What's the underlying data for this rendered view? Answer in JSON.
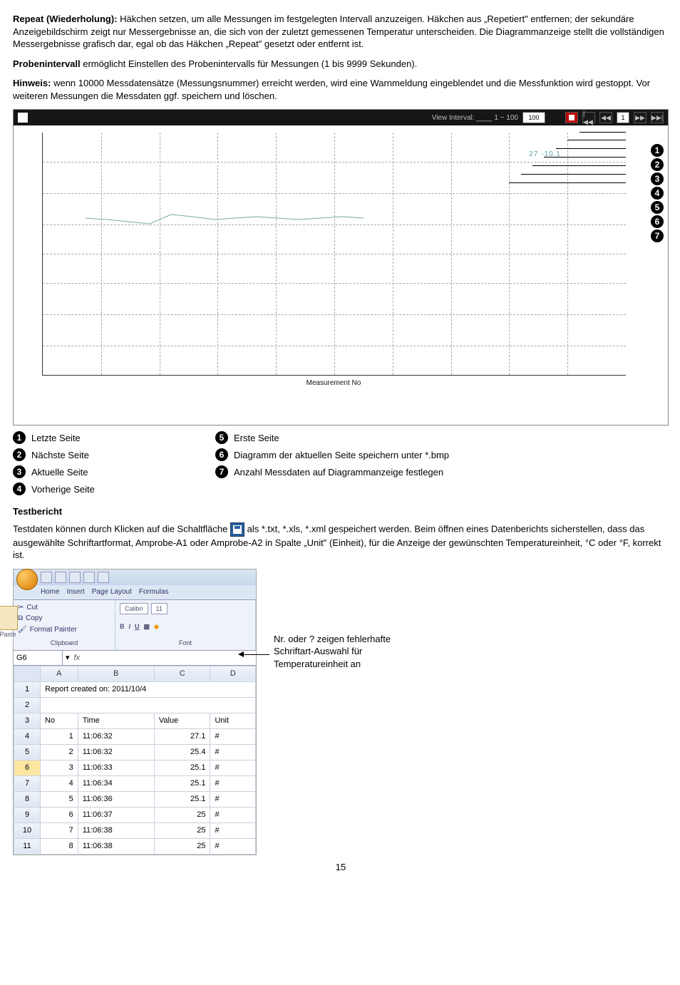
{
  "p1": {
    "title": "Repeat (Wiederholung):",
    "text": " Häkchen setzen, um alle Messungen im festgelegten Intervall anzuzeigen. Häkchen aus „Repetiert\" entfernen; der sekundäre Anzeigebildschirm zeigt nur Messergebnisse an, die sich von der zuletzt gemessenen Temperatur unterscheiden. Die Diagrammanzeige stellt die vollständigen Messergebnisse grafisch dar, egal ob das Häkchen „Repeat\" gesetzt oder entfernt ist."
  },
  "p2": {
    "title": "Probenintervall",
    "text": " ermöglicht Einstellen des Probenintervalls für Messungen (1 bis 9999 Sekunden)."
  },
  "p3": {
    "title": "Hinweis:",
    "text": " wenn 10000 Messdatensätze (Messungsnummer) erreicht werden, wird eine Warnmeldung eingeblendet und die Messfunktion wird gestoppt. Vor weiteren Messungen die Messdaten ggf. speichern und löschen."
  },
  "chart": {
    "header_text": "View Interval: ____ 1 ~ 100",
    "header_count": "100",
    "btn_first": "|◀◀",
    "btn_prev": "◀◀",
    "btn_page": "1",
    "btn_next": "▶▶",
    "btn_last": "▶▶|",
    "annot": "27   -10.1",
    "xlabel": "Measurement No"
  },
  "legend": [
    {
      "num": "1",
      "text": "Letzte Seite"
    },
    {
      "num": "2",
      "text": "Nächste Seite"
    },
    {
      "num": "3",
      "text": "Aktuelle Seite"
    },
    {
      "num": "4",
      "text": "Vorherige Seite"
    },
    {
      "num": "5",
      "text": "Erste Seite"
    },
    {
      "num": "6",
      "text": "Diagramm der aktuellen Seite speichern unter *.bmp"
    },
    {
      "num": "7",
      "text": "Anzahl Messdaten auf Diagrammanzeige festlegen"
    }
  ],
  "testbericht": {
    "title": "Testbericht",
    "text1": "Testdaten können durch Klicken auf die Schaltfläche ",
    "text2": " als *.txt, *.xls, *.xml gespeichert werden. Beim öffnen eines Datenberichts sicherstellen, dass das ausgewählte Schriftartformat, Amprobe-A1 oder Amprobe-A2 in Spalte „Unit\" (Einheit), für die Anzeige der gewünschten Temperatureinheit, °C oder °F, korrekt ist."
  },
  "excel": {
    "tabs": [
      "Home",
      "Insert",
      "Page Layout",
      "Formulas"
    ],
    "clip": {
      "cut": "Cut",
      "copy": "Copy",
      "fp": "Format Painter",
      "label": "Clipboard"
    },
    "font": {
      "name": "Calibri",
      "size": "11",
      "label": "Font"
    },
    "namebox": "G6",
    "report_line": "Report created on: 2011/10/4",
    "cols": [
      "A",
      "B",
      "C",
      "D"
    ],
    "headers": {
      "no": "No",
      "time": "Time",
      "value": "Value",
      "unit": "Unit"
    },
    "rows": [
      {
        "r": "4",
        "no": "1",
        "time": "11:06:32",
        "value": "27.1",
        "unit": "#"
      },
      {
        "r": "5",
        "no": "2",
        "time": "11:06:32",
        "value": "25.4",
        "unit": "#"
      },
      {
        "r": "6",
        "no": "3",
        "time": "11:06:33",
        "value": "25.1",
        "unit": "#",
        "hl": true
      },
      {
        "r": "7",
        "no": "4",
        "time": "11:06:34",
        "value": "25.1",
        "unit": "#"
      },
      {
        "r": "8",
        "no": "5",
        "time": "11:06:36",
        "value": "25.1",
        "unit": "#"
      },
      {
        "r": "9",
        "no": "6",
        "time": "11:06:37",
        "value": "25",
        "unit": "#"
      },
      {
        "r": "10",
        "no": "7",
        "time": "11:06:38",
        "value": "25",
        "unit": "#"
      },
      {
        "r": "11",
        "no": "8",
        "time": "11:06:38",
        "value": "25",
        "unit": "#"
      }
    ]
  },
  "callout": {
    "l1": "Nr. oder ? zeigen fehlerhafte",
    "l2": "Schriftart-Auswahl für",
    "l3": "Temperatureinheit an"
  },
  "page": "15"
}
